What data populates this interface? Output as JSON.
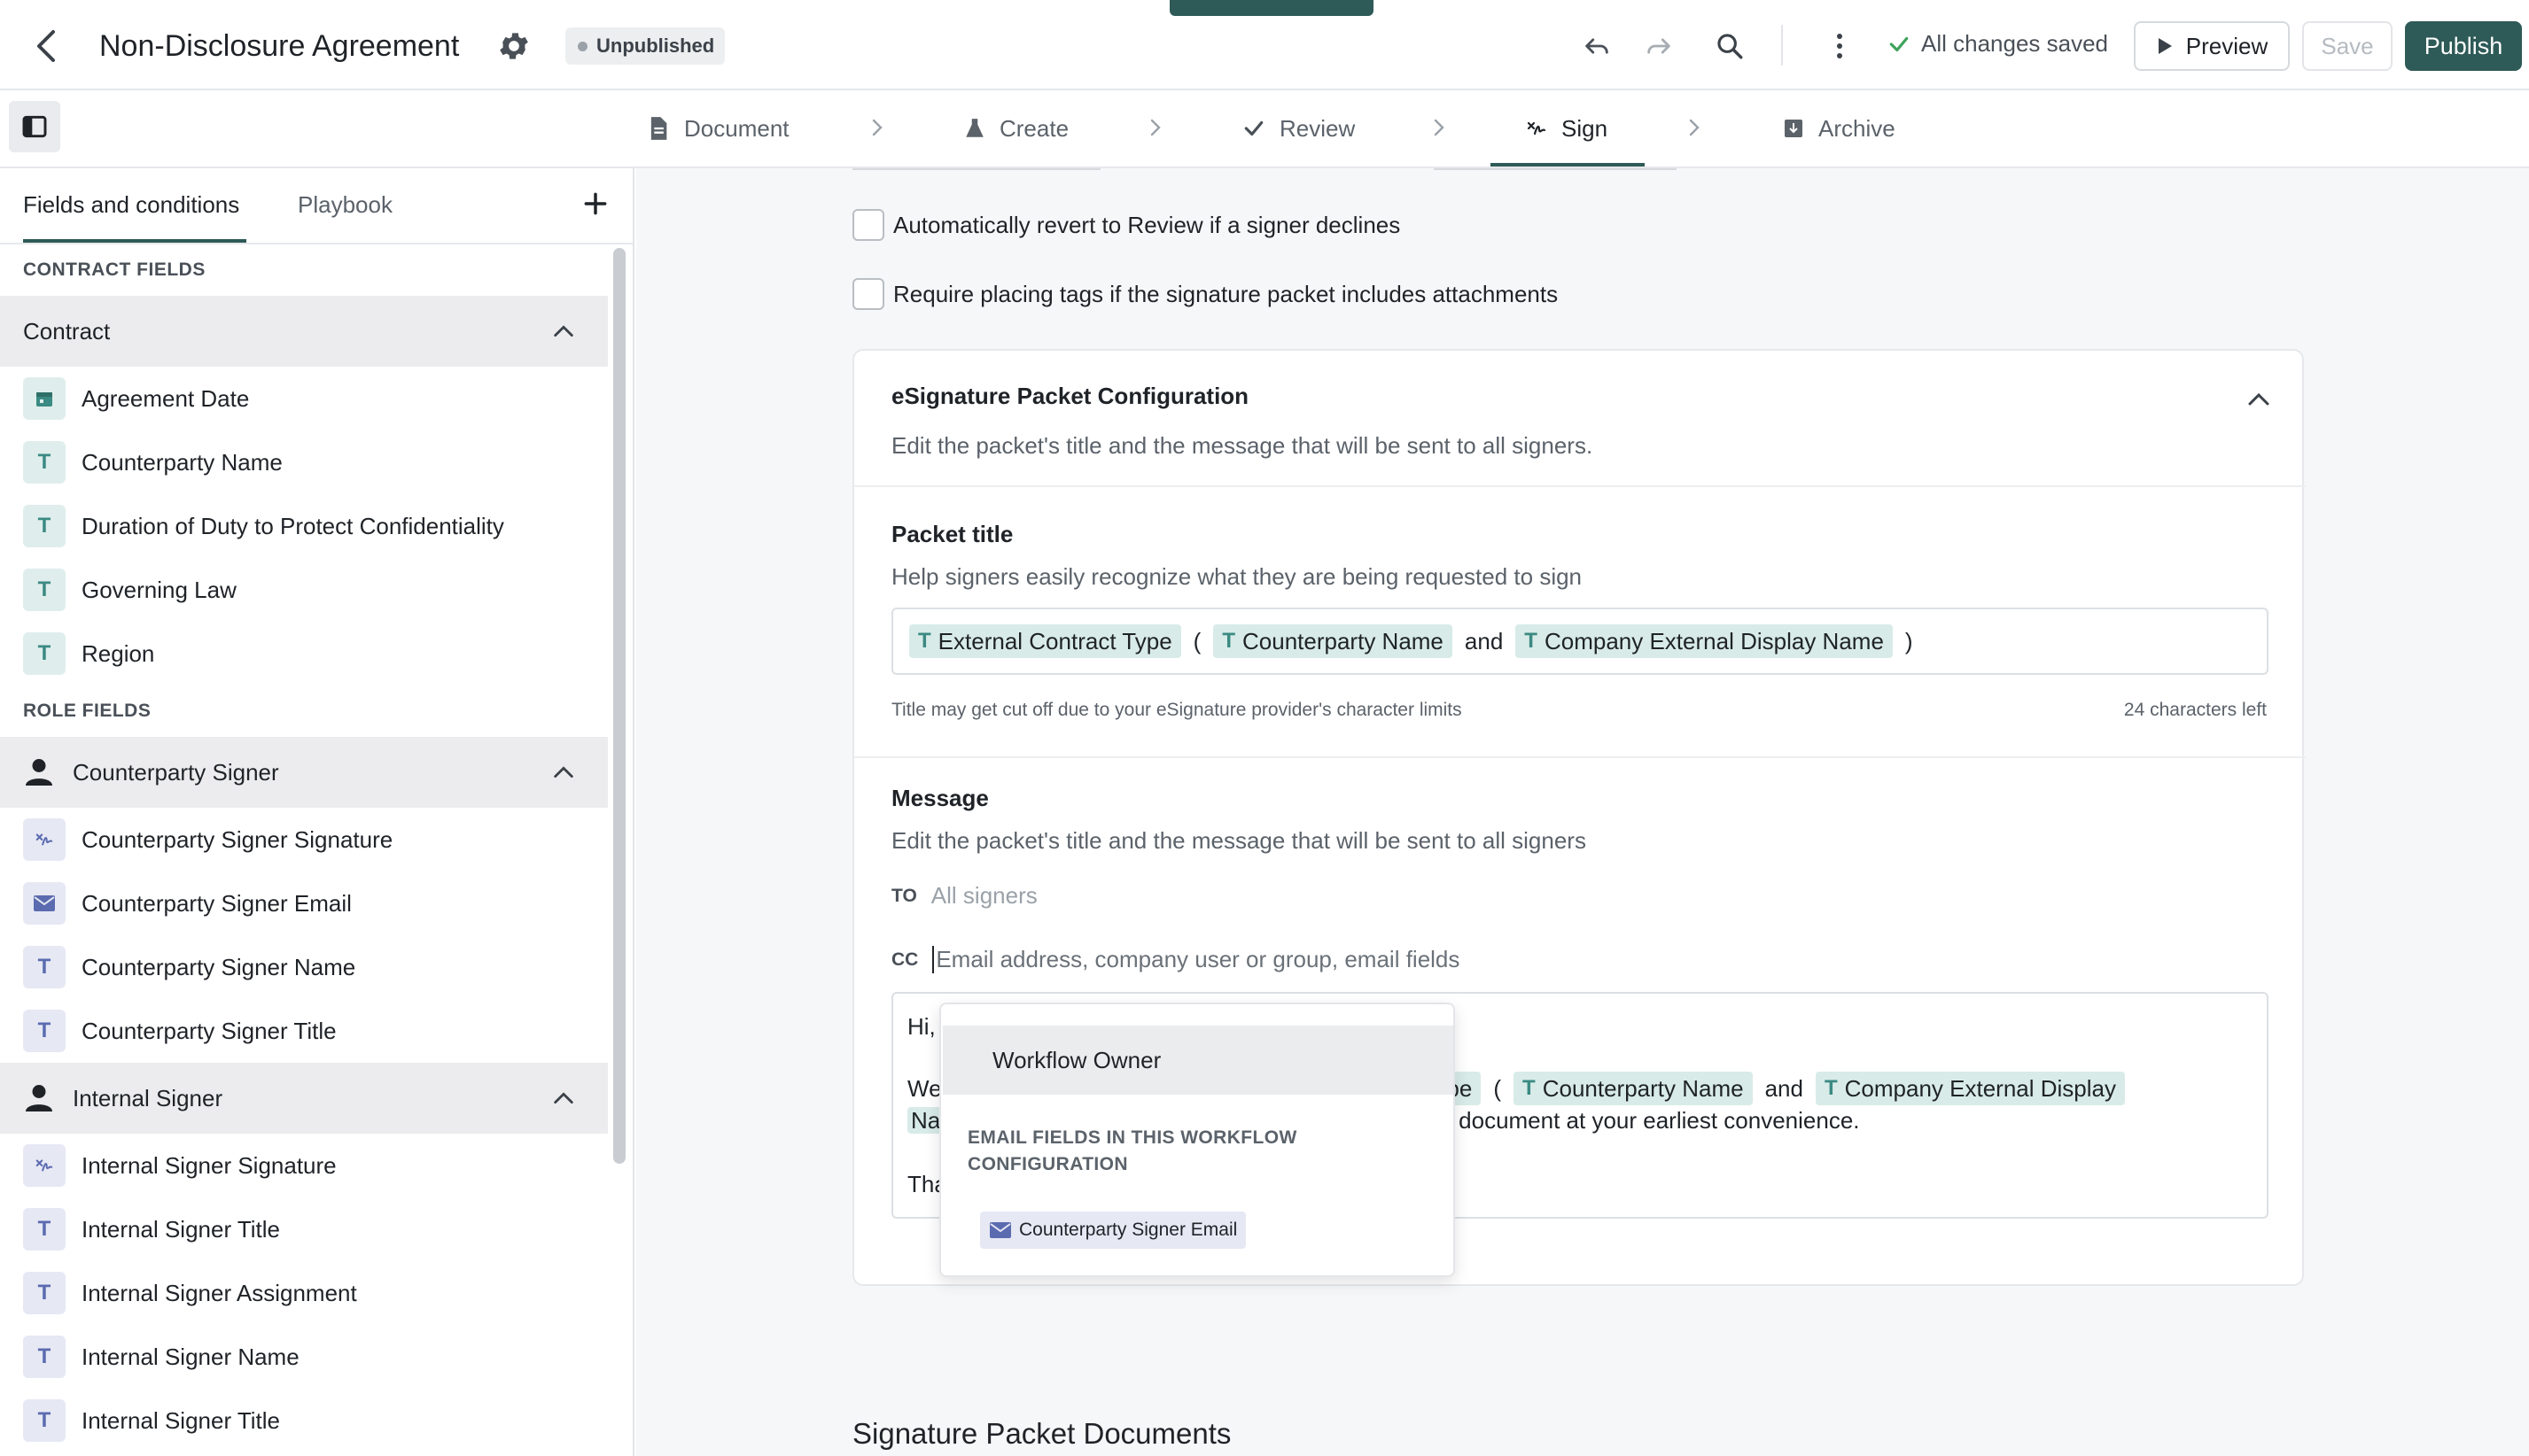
{
  "header": {
    "title": "Non-Disclosure Agreement",
    "status_badge": "Unpublished",
    "saved_status": "All changes saved",
    "preview_label": "Preview",
    "save_label": "Save",
    "publish_label": "Publish"
  },
  "steps": [
    {
      "label": "Document",
      "icon": "document-icon"
    },
    {
      "label": "Create",
      "icon": "flask-icon"
    },
    {
      "label": "Review",
      "icon": "check-icon"
    },
    {
      "label": "Sign",
      "icon": "signature-icon",
      "active": true
    },
    {
      "label": "Archive",
      "icon": "archive-icon"
    }
  ],
  "left_panel": {
    "tabs": [
      "Fields and conditions",
      "Playbook"
    ],
    "active_tab": "Fields and conditions",
    "contract_section": "CONTRACT FIELDS",
    "contract_group": "Contract",
    "contract_fields": [
      {
        "label": "Agreement Date",
        "icon": "calendar-icon"
      },
      {
        "label": "Counterparty Name",
        "icon": "text-icon"
      },
      {
        "label": "Duration of Duty to Protect Confidentiality",
        "icon": "text-icon"
      },
      {
        "label": "Governing Law",
        "icon": "text-icon"
      },
      {
        "label": "Region",
        "icon": "text-icon"
      }
    ],
    "role_section": "ROLE FIELDS",
    "counterparty_group": "Counterparty Signer",
    "counterparty_fields": [
      {
        "label": "Counterparty Signer Signature",
        "icon": "signature-icon"
      },
      {
        "label": "Counterparty Signer Email",
        "icon": "email-icon"
      },
      {
        "label": "Counterparty Signer Name",
        "icon": "text-icon"
      },
      {
        "label": "Counterparty Signer Title",
        "icon": "text-icon"
      }
    ],
    "internal_group": "Internal Signer",
    "internal_fields": [
      {
        "label": "Internal Signer Signature",
        "icon": "signature-icon"
      },
      {
        "label": "Internal Signer Title",
        "icon": "text-icon"
      },
      {
        "label": "Internal Signer Assignment",
        "icon": "text-icon"
      },
      {
        "label": "Internal Signer Name",
        "icon": "text-icon"
      },
      {
        "label": "Internal Signer Title",
        "icon": "text-icon"
      }
    ]
  },
  "main": {
    "checkbox_revert": "Automatically revert to Review if a signer declines",
    "checkbox_tags": "Require placing tags if the signature packet includes attachments",
    "card": {
      "title": "eSignature Packet Configuration",
      "subtitle": "Edit the packet's title and the message that will be sent to all signers.",
      "packet_title_label": "Packet title",
      "packet_title_help": "Help signers easily recognize what they are being requested to sign",
      "packet_title_tokens": {
        "t1": "External Contract Type",
        "open": "(",
        "t2": "Counterparty Name",
        "and": "and",
        "t3": "Company External Display Name",
        "close": ")"
      },
      "title_note": "Title may get cut off due to your eSignature provider's character limits",
      "chars_left": "24 characters left",
      "message_label": "Message",
      "message_help": "Edit the packet's title and the message that will be sent to all signers",
      "to_label": "TO",
      "to_value": "All signers",
      "cc_label": "CC",
      "cc_placeholder": "Email address, company user or group, email fields",
      "msg_hi": "Hi,",
      "msg_we": "We",
      "msg_token_a": "ct Type",
      "msg_open": "(",
      "msg_token_b": "Counterparty Name",
      "msg_and": "and",
      "msg_token_c": "Company External Display",
      "msg_nar": "Nar",
      "msg_rest": "ne document at your earliest convenience.",
      "msg_tha": "Tha"
    },
    "section_heading": "Signature Packet Documents"
  },
  "dropdown": {
    "item": "Workflow Owner",
    "header": "EMAIL FIELDS IN THIS WORKFLOW CONFIGURATION",
    "chip": "Counterparty Signer Email"
  },
  "colors": {
    "accent": "#2e5a57",
    "token_bg": "#d8ebe8",
    "email_chip_bg": "#e6e8f4"
  }
}
